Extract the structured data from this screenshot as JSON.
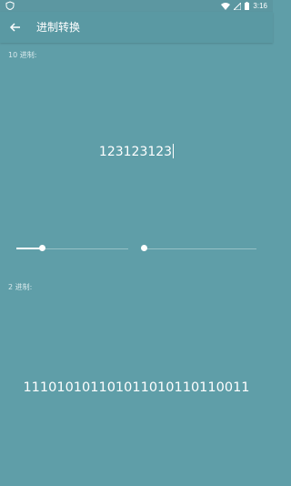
{
  "status_bar": {
    "time": "3:16",
    "icons": [
      "shield-icon",
      "wifi-icon",
      "signal-icon",
      "battery-icon"
    ]
  },
  "app_bar": {
    "title": "进制转换",
    "back_icon": "arrow-left-icon"
  },
  "decimal": {
    "label": "10 进制:",
    "value": "123123123"
  },
  "binary": {
    "label": "2 进制:",
    "value": "111010101101011010110110011"
  },
  "sliders": [
    {
      "level": 0.24
    },
    {
      "level": 0.0
    }
  ],
  "colors": {
    "background": "#5f9ea8",
    "app_bar": "#5a99a3",
    "text": "#ffffff"
  }
}
